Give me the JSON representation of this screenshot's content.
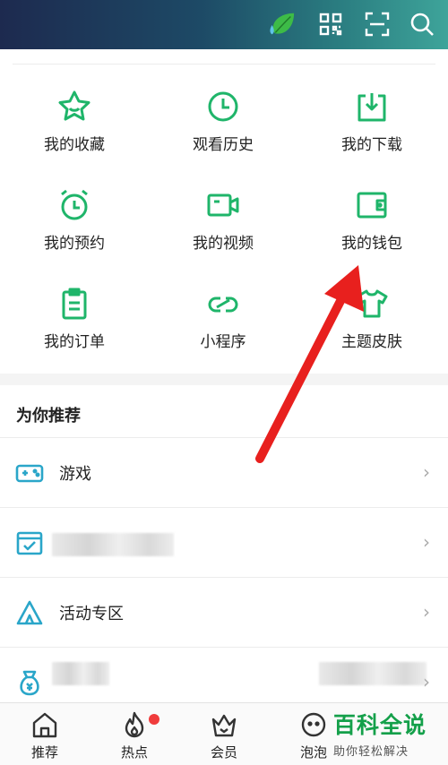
{
  "header": {
    "icons": [
      "leaf-icon",
      "qr-code-icon",
      "scan-icon",
      "search-icon"
    ]
  },
  "grid": {
    "items": [
      {
        "label": "我的收藏",
        "icon": "star-icon"
      },
      {
        "label": "观看历史",
        "icon": "clock-icon"
      },
      {
        "label": "我的下载",
        "icon": "download-icon"
      },
      {
        "label": "我的预约",
        "icon": "alarm-icon"
      },
      {
        "label": "我的视频",
        "icon": "video-camera-icon"
      },
      {
        "label": "我的钱包",
        "icon": "wallet-icon"
      },
      {
        "label": "我的订单",
        "icon": "clipboard-icon"
      },
      {
        "label": "小程序",
        "icon": "link-icon"
      },
      {
        "label": "主题皮肤",
        "icon": "tshirt-icon"
      }
    ]
  },
  "recommend": {
    "title": "为你推荐",
    "rows": [
      {
        "label": "游戏",
        "icon": "gamepad-icon"
      },
      {
        "label": "",
        "icon": "checklist-icon"
      },
      {
        "label": "活动专区",
        "icon": "tent-icon"
      },
      {
        "label": "",
        "icon": "money-bag-icon"
      }
    ],
    "chevron": "›"
  },
  "bottom_nav": {
    "items": [
      {
        "label": "推荐",
        "icon": "home-icon"
      },
      {
        "label": "热点",
        "icon": "flame-icon"
      },
      {
        "label": "会员",
        "icon": "crown-icon"
      },
      {
        "label": "泡泡",
        "icon": "bubble-icon"
      }
    ]
  },
  "watermark": {
    "title": "百科全说",
    "subtitle": "助你轻松解决"
  },
  "colors": {
    "accent": "#1fb56a",
    "arrow": "#e8201e"
  }
}
